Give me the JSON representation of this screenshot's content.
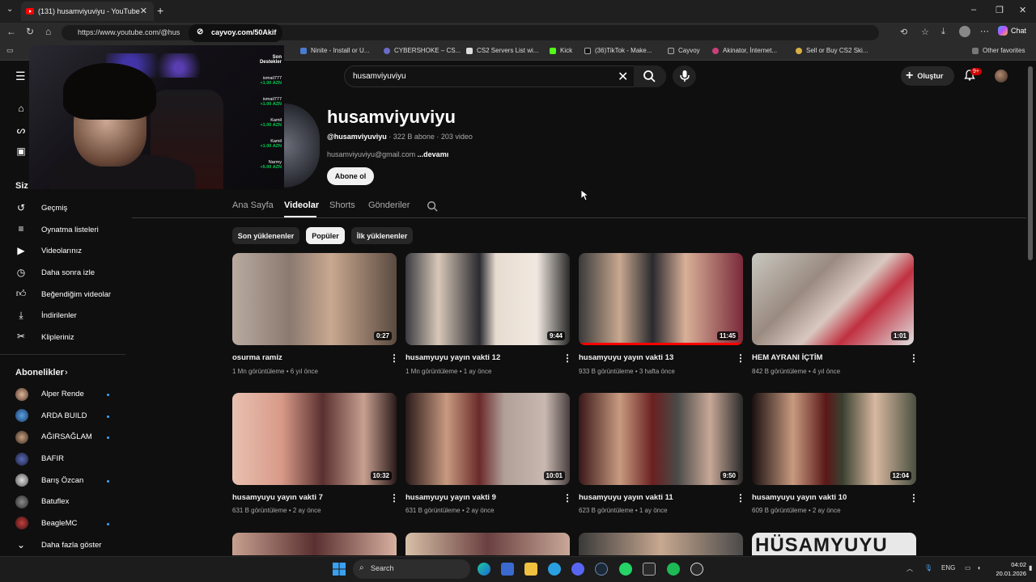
{
  "browser": {
    "tab_title": "(131) husamviyuviyu - YouTube",
    "url": "https://www.youtube.com/@hus",
    "url_popup": "cayvoy.com/50Akif",
    "bookmarks": [
      "Ninite - Install or U...",
      "CYBERSHOKE – CS...",
      "CS2 Servers List wi...",
      "Kick",
      "(36)TikTok - Make...",
      "Cayvoy",
      "Akinator, İnternet...",
      "Sell or Buy CS2 Ski..."
    ],
    "other_favorites": "Other favorites",
    "chat": "Chat"
  },
  "youtube": {
    "search_value": "husamviyuviyu",
    "create_label": "Oluştur",
    "notif_badge": "9+"
  },
  "overlay": {
    "header": "Son Destekler",
    "donations": [
      {
        "name": "ismail777",
        "amount": "+1.00 AZN"
      },
      {
        "name": "ismail777",
        "amount": "+1.00 AZN"
      },
      {
        "name": "Kamil",
        "amount": "+1.00 AZN"
      },
      {
        "name": "Kamil",
        "amount": "+1.00 AZN"
      },
      {
        "name": "Narmy",
        "amount": "+5.00 AZN"
      }
    ]
  },
  "sidebar": {
    "section_you": "Siz",
    "items": [
      "Geçmiş",
      "Oynatma listeleri",
      "Videolarınız",
      "Daha sonra izle",
      "Beğendiğim videolar",
      "İndirilenler",
      "Klipleriniz"
    ],
    "subscriptions_header": "Abonelikler",
    "subscriptions": [
      "Alper Rende",
      "ARDA BUILD",
      "AĞIRSAĞLAM",
      "BAFIR",
      "Barış Özcan",
      "Batuflex",
      "BeagleMC"
    ],
    "show_more": "Daha fazla göster"
  },
  "channel": {
    "name": "husamviyuviyu",
    "handle": "@husamviyuviyu",
    "stats": " · 322 B abone · 203 video",
    "email": "husamviyuviyu@gmail.com",
    "more": " ...devamı",
    "subscribe": "Abone ol",
    "tabs": [
      "Ana Sayfa",
      "Videolar",
      "Shorts",
      "Gönderiler"
    ],
    "chips": [
      "Son yüklenenler",
      "Popüler",
      "İlk yüklenenler"
    ]
  },
  "videos": [
    {
      "title": "osurma ramiz",
      "meta": "1 Mn görüntüleme • 6 yıl önce",
      "duration": "0:27"
    },
    {
      "title": "husamyuyu yayın vakti 12",
      "meta": "1 Mn görüntüleme • 1 ay önce",
      "duration": "9:44"
    },
    {
      "title": "husamyuyu yayın vakti 13",
      "meta": "933 B görüntüleme • 3 hafta önce",
      "duration": "11:45"
    },
    {
      "title": "HEM AYRANI İÇTİM",
      "meta": "842 B görüntüleme • 4 yıl önce",
      "duration": "1:01"
    },
    {
      "title": "husamyuyu yayın vakti 7",
      "meta": "631 B görüntüleme • 2 ay önce",
      "duration": "10:32"
    },
    {
      "title": "husamyuyu yayın vakti 9",
      "meta": "631 B görüntüleme • 2 ay önce",
      "duration": "10:01"
    },
    {
      "title": "husamyuyu yayın vakti 11",
      "meta": "623 B görüntüleme • 1 ay önce",
      "duration": "9:50"
    },
    {
      "title": "husamyuyu yayın vakti 10",
      "meta": "609 B görüntüleme • 2 ay önce",
      "duration": "12:04"
    }
  ],
  "row3_thumb_text": "HÜSAMYUYU",
  "taskbar": {
    "search": "Search",
    "lang": "ENG",
    "time": "04:02",
    "date": "20.01.2026"
  }
}
